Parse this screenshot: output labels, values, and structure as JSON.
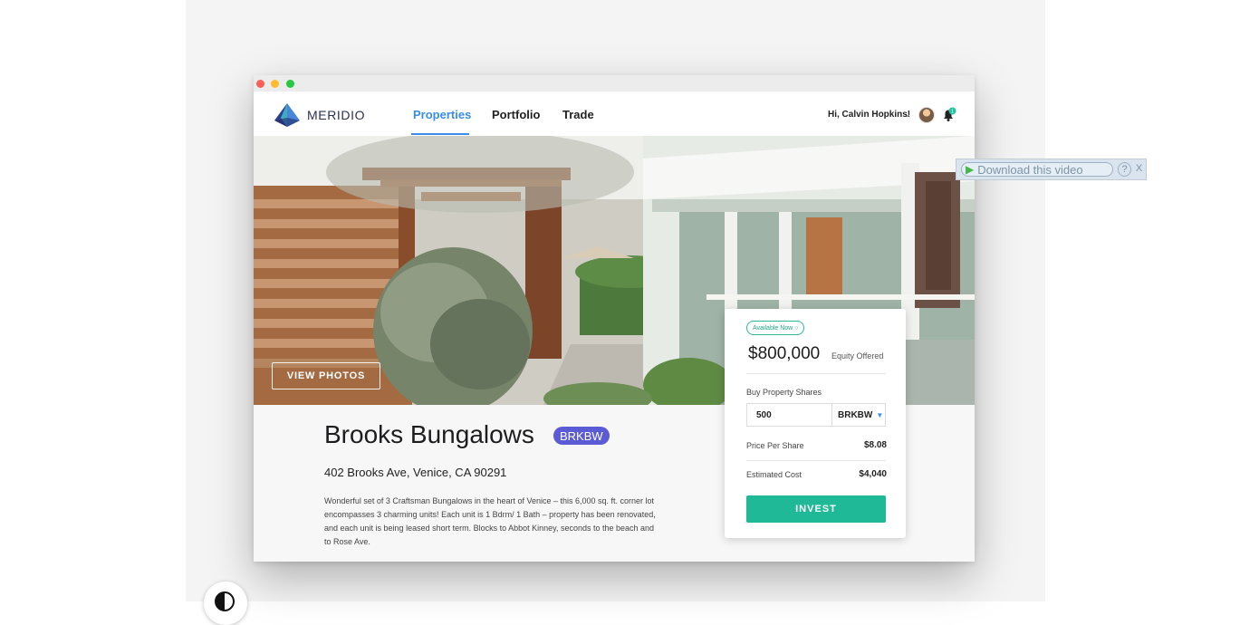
{
  "navbar": {
    "brand": "MERIDIO",
    "links": [
      "Properties",
      "Portfolio",
      "Trade"
    ],
    "active": "Properties",
    "greeting": "Hi, Calvin Hopkins!",
    "notification_count": "1"
  },
  "hero": {
    "view_photos": "VIEW PHOTOS"
  },
  "property": {
    "name": "Brooks Bungalows",
    "ticker": "BRKBW",
    "address": "402 Brooks Ave, Venice, CA 90291",
    "description": "Wonderful set of 3 Craftsman Bungalows in the heart of Venice – this 6,000 sq. ft. corner lot encompasses 3 charming units! Each unit is 1 Bdrm/ 1 Bath – property has been renovated, and each unit is being leased short term. Blocks to Abbot Kinney, seconds to the beach and to Rose Ave."
  },
  "card": {
    "status": "Available Now",
    "price": "$800,000",
    "price_label": "Equity Offered",
    "buy_label": "Buy Property Shares",
    "shares_value": "500",
    "ticker": "BRKBW",
    "price_per_share_label": "Price Per Share",
    "price_per_share": "$8.08",
    "estimated_cost_label": "Estimated Cost",
    "estimated_cost": "$4,040",
    "invest": "INVEST"
  },
  "download": {
    "label": "Download this video",
    "help": "?",
    "close": "X"
  },
  "colors": {
    "accent": "#3a8ee6",
    "invest": "#1fb998",
    "badge": "#5c5bd6"
  }
}
